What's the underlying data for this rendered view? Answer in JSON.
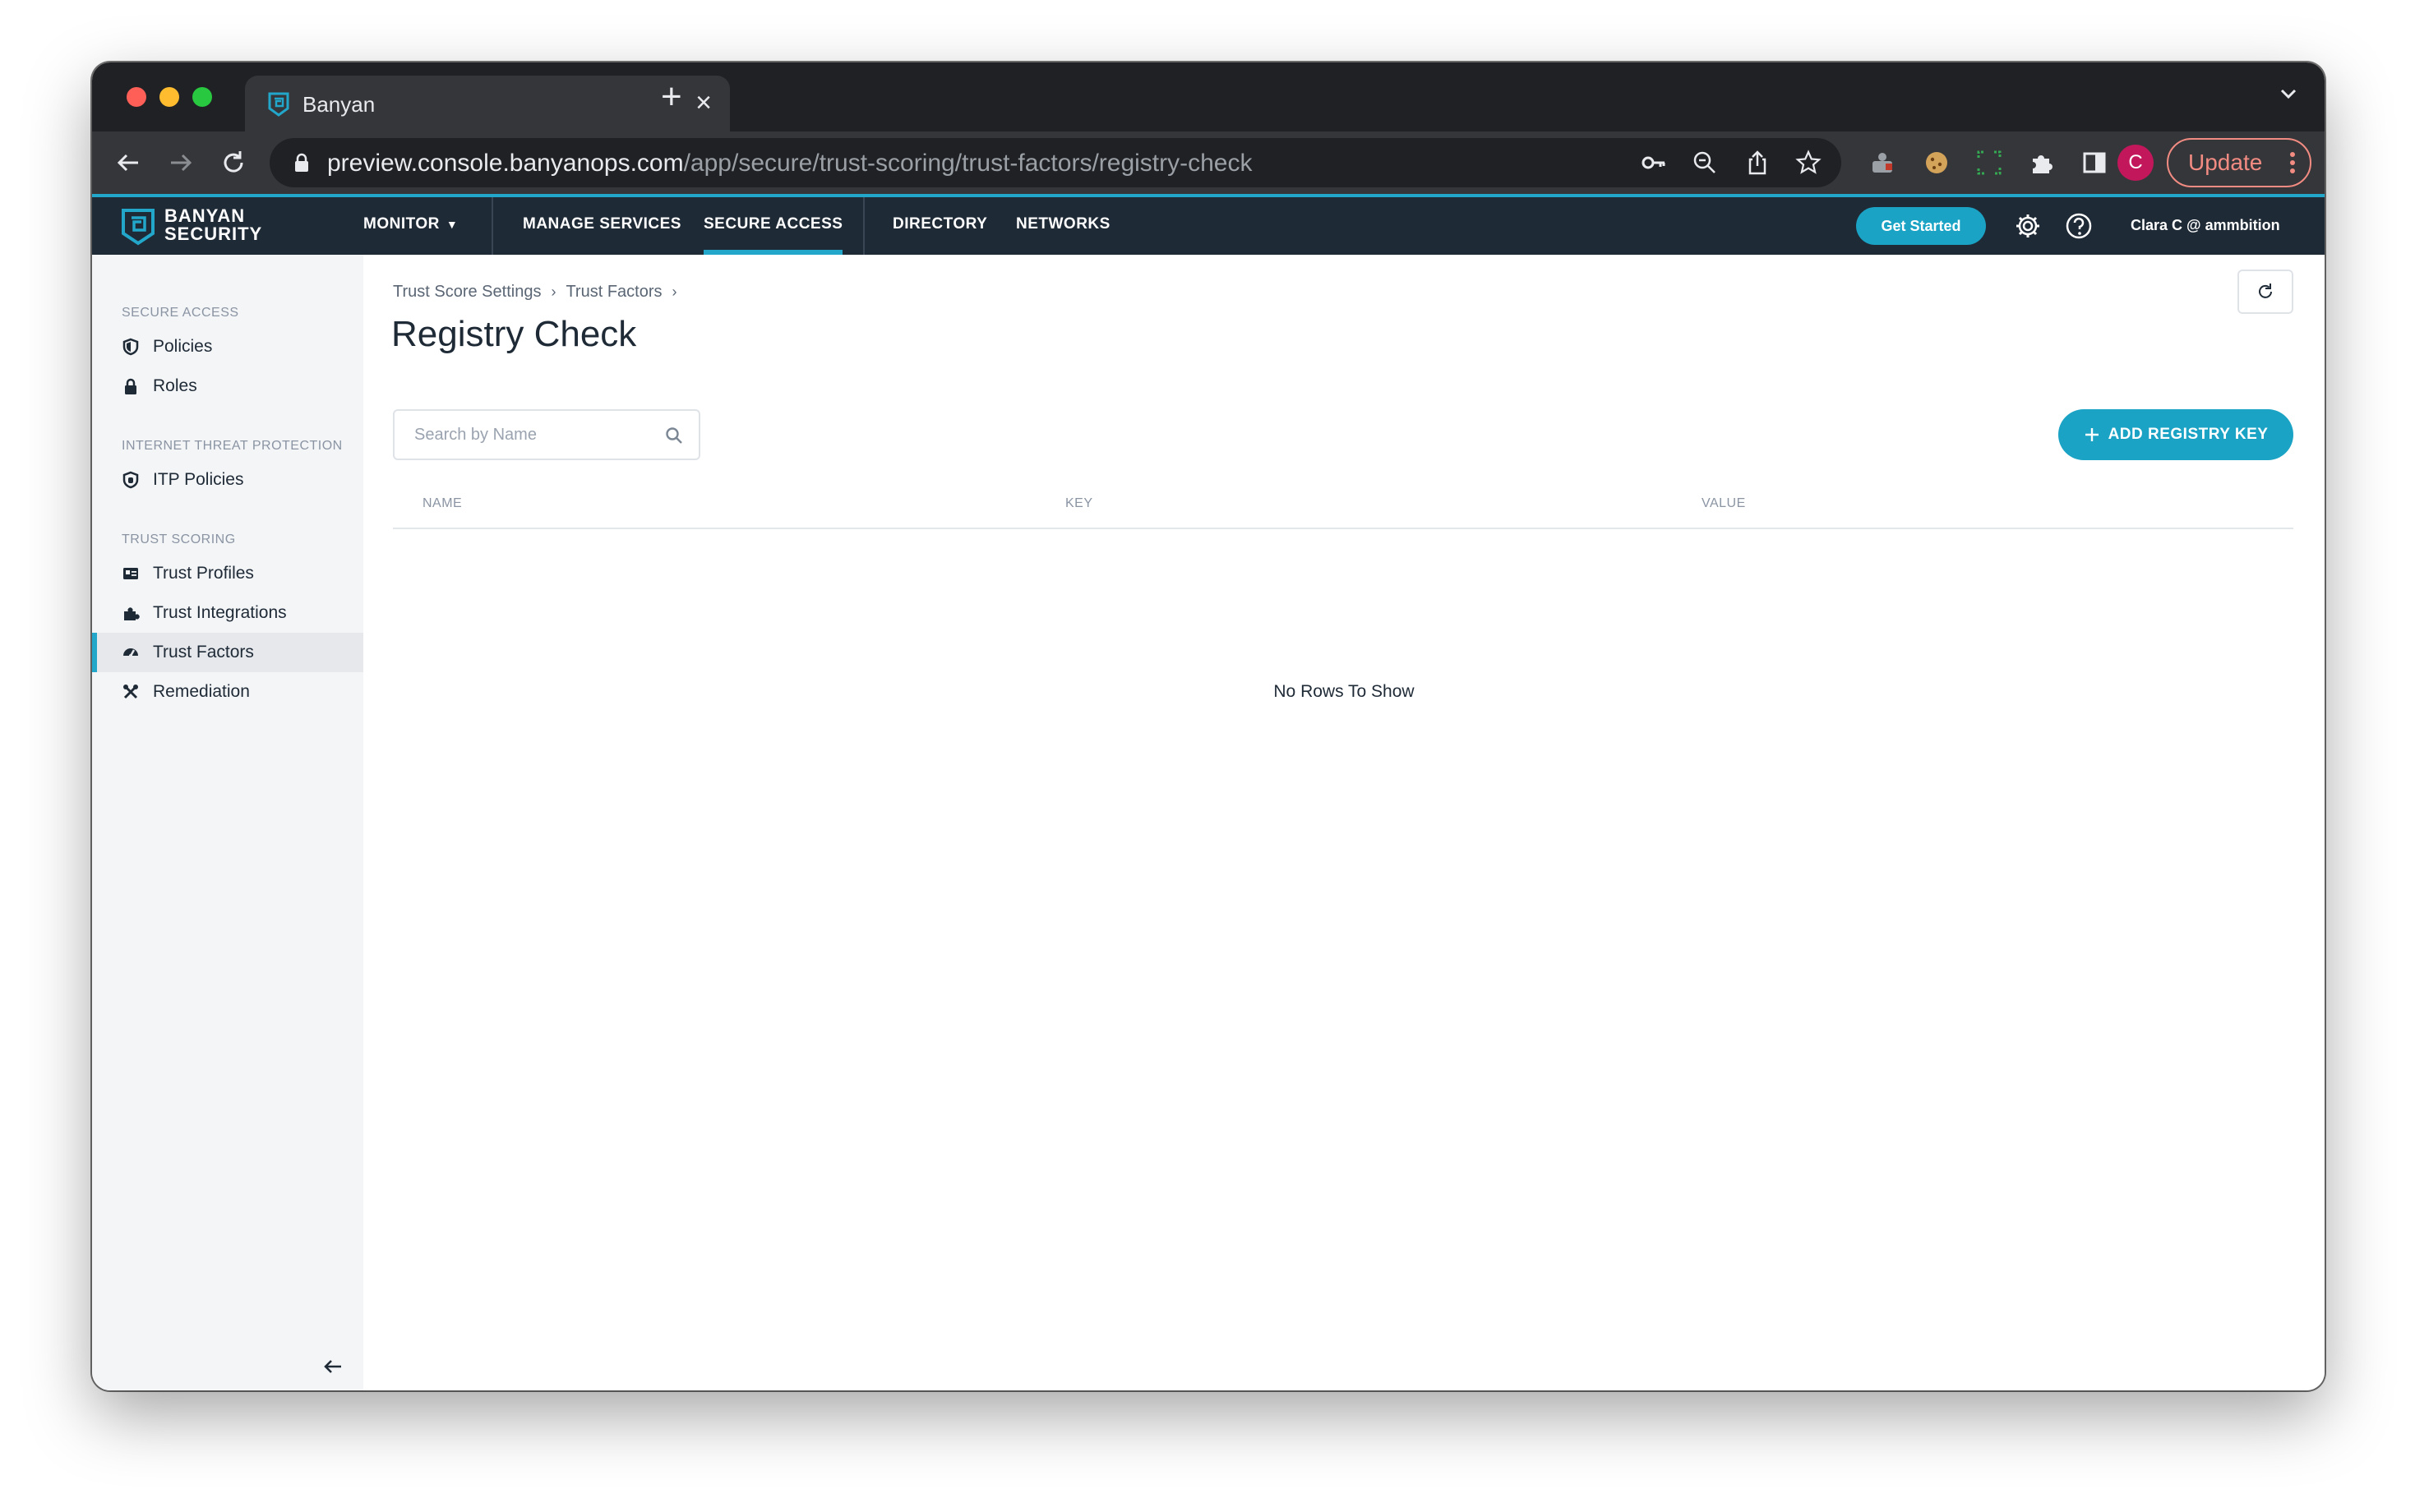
{
  "browser": {
    "tab_title": "Banyan",
    "url_host": "preview.console.banyanops.com",
    "url_path": "/app/secure/trust-scoring/trust-factors/registry-check",
    "profile_initial": "C",
    "update_label": "Update"
  },
  "header": {
    "logo_line1": "BANYAN",
    "logo_line2": "SECURITY",
    "nav": {
      "monitor": "MONITOR",
      "manage_services": "MANAGE SERVICES",
      "secure_access": "SECURE ACCESS",
      "directory": "DIRECTORY",
      "networks": "NETWORKS"
    },
    "get_started": "Get Started",
    "user": "Clara C @ ammbition"
  },
  "sidebar": {
    "sections": {
      "secure_access": "SECURE ACCESS",
      "itp": "INTERNET THREAT PROTECTION",
      "trust_scoring": "TRUST SCORING"
    },
    "items": {
      "policies": "Policies",
      "roles": "Roles",
      "itp_policies": "ITP Policies",
      "trust_profiles": "Trust Profiles",
      "trust_integrations": "Trust Integrations",
      "trust_factors": "Trust Factors",
      "remediation": "Remediation"
    },
    "active_item": "Trust Factors"
  },
  "main": {
    "breadcrumb": [
      "Trust Score Settings",
      "Trust Factors"
    ],
    "title": "Registry Check",
    "search_placeholder": "Search by Name",
    "add_button": "ADD REGISTRY KEY",
    "columns": [
      "NAME",
      "KEY",
      "VALUE"
    ],
    "empty_message": "No Rows To Show"
  },
  "colors": {
    "accent": "#1aa3c4",
    "header_bg": "#1f2a37",
    "sidebar_bg": "#f4f5f7"
  }
}
